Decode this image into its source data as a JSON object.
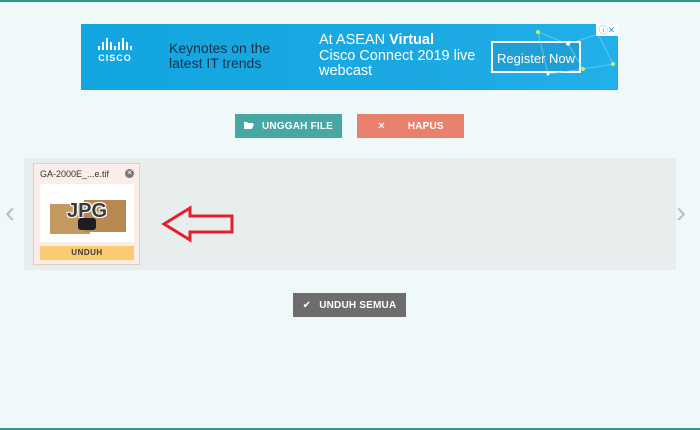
{
  "ad": {
    "logo_text": "CISCO",
    "tagline": "Keynotes on the latest IT trends",
    "event_prefix": "At ASEAN ",
    "event_highlight": "Virtual",
    "event_rest": "Cisco Connect 2019 live webcast",
    "cta": "Register Now",
    "adchoices_icon": "adchoices-icon",
    "close_icon": "close-icon"
  },
  "toolbar": {
    "upload_label": "UNGGAH FILE",
    "upload_icon": "folder-open-icon",
    "delete_label": "HAPUS",
    "delete_icon": "x-icon"
  },
  "gallery": {
    "files": [
      {
        "name": "GA-2000E_...e.tif",
        "badge": "JPG",
        "download_label": "UNDUH"
      }
    ],
    "prev_icon": "chevron-left-icon",
    "next_icon": "chevron-right-icon"
  },
  "footer": {
    "download_all_label": "UNDUH SEMUA",
    "download_all_icon": "check-icon"
  },
  "colors": {
    "accent_teal": "#47a8a3",
    "delete_red": "#e9826d",
    "download_all_gray": "#6d6d6d",
    "unduh_yellow": "#f9cc72",
    "ad_blue": "#1ba8e2",
    "annotation_red": "#e3202a"
  }
}
